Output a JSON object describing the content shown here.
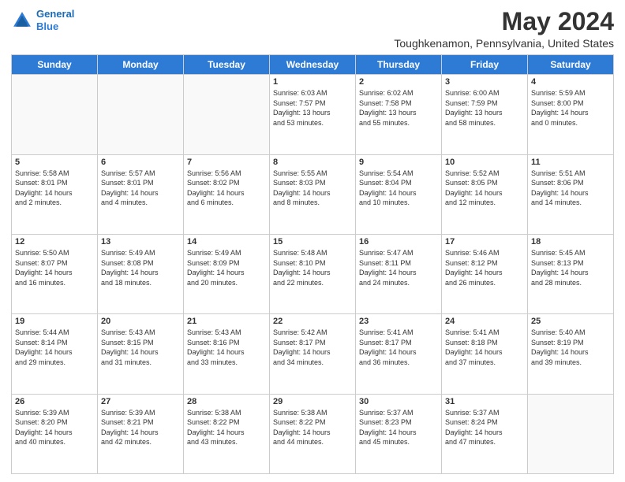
{
  "header": {
    "logo_line1": "General",
    "logo_line2": "Blue",
    "main_title": "May 2024",
    "subtitle": "Toughkenamon, Pennsylvania, United States"
  },
  "days_of_week": [
    "Sunday",
    "Monday",
    "Tuesday",
    "Wednesday",
    "Thursday",
    "Friday",
    "Saturday"
  ],
  "weeks": [
    [
      {
        "day": "",
        "info": ""
      },
      {
        "day": "",
        "info": ""
      },
      {
        "day": "",
        "info": ""
      },
      {
        "day": "1",
        "info": "Sunrise: 6:03 AM\nSunset: 7:57 PM\nDaylight: 13 hours\nand 53 minutes."
      },
      {
        "day": "2",
        "info": "Sunrise: 6:02 AM\nSunset: 7:58 PM\nDaylight: 13 hours\nand 55 minutes."
      },
      {
        "day": "3",
        "info": "Sunrise: 6:00 AM\nSunset: 7:59 PM\nDaylight: 13 hours\nand 58 minutes."
      },
      {
        "day": "4",
        "info": "Sunrise: 5:59 AM\nSunset: 8:00 PM\nDaylight: 14 hours\nand 0 minutes."
      }
    ],
    [
      {
        "day": "5",
        "info": "Sunrise: 5:58 AM\nSunset: 8:01 PM\nDaylight: 14 hours\nand 2 minutes."
      },
      {
        "day": "6",
        "info": "Sunrise: 5:57 AM\nSunset: 8:01 PM\nDaylight: 14 hours\nand 4 minutes."
      },
      {
        "day": "7",
        "info": "Sunrise: 5:56 AM\nSunset: 8:02 PM\nDaylight: 14 hours\nand 6 minutes."
      },
      {
        "day": "8",
        "info": "Sunrise: 5:55 AM\nSunset: 8:03 PM\nDaylight: 14 hours\nand 8 minutes."
      },
      {
        "day": "9",
        "info": "Sunrise: 5:54 AM\nSunset: 8:04 PM\nDaylight: 14 hours\nand 10 minutes."
      },
      {
        "day": "10",
        "info": "Sunrise: 5:52 AM\nSunset: 8:05 PM\nDaylight: 14 hours\nand 12 minutes."
      },
      {
        "day": "11",
        "info": "Sunrise: 5:51 AM\nSunset: 8:06 PM\nDaylight: 14 hours\nand 14 minutes."
      }
    ],
    [
      {
        "day": "12",
        "info": "Sunrise: 5:50 AM\nSunset: 8:07 PM\nDaylight: 14 hours\nand 16 minutes."
      },
      {
        "day": "13",
        "info": "Sunrise: 5:49 AM\nSunset: 8:08 PM\nDaylight: 14 hours\nand 18 minutes."
      },
      {
        "day": "14",
        "info": "Sunrise: 5:49 AM\nSunset: 8:09 PM\nDaylight: 14 hours\nand 20 minutes."
      },
      {
        "day": "15",
        "info": "Sunrise: 5:48 AM\nSunset: 8:10 PM\nDaylight: 14 hours\nand 22 minutes."
      },
      {
        "day": "16",
        "info": "Sunrise: 5:47 AM\nSunset: 8:11 PM\nDaylight: 14 hours\nand 24 minutes."
      },
      {
        "day": "17",
        "info": "Sunrise: 5:46 AM\nSunset: 8:12 PM\nDaylight: 14 hours\nand 26 minutes."
      },
      {
        "day": "18",
        "info": "Sunrise: 5:45 AM\nSunset: 8:13 PM\nDaylight: 14 hours\nand 28 minutes."
      }
    ],
    [
      {
        "day": "19",
        "info": "Sunrise: 5:44 AM\nSunset: 8:14 PM\nDaylight: 14 hours\nand 29 minutes."
      },
      {
        "day": "20",
        "info": "Sunrise: 5:43 AM\nSunset: 8:15 PM\nDaylight: 14 hours\nand 31 minutes."
      },
      {
        "day": "21",
        "info": "Sunrise: 5:43 AM\nSunset: 8:16 PM\nDaylight: 14 hours\nand 33 minutes."
      },
      {
        "day": "22",
        "info": "Sunrise: 5:42 AM\nSunset: 8:17 PM\nDaylight: 14 hours\nand 34 minutes."
      },
      {
        "day": "23",
        "info": "Sunrise: 5:41 AM\nSunset: 8:17 PM\nDaylight: 14 hours\nand 36 minutes."
      },
      {
        "day": "24",
        "info": "Sunrise: 5:41 AM\nSunset: 8:18 PM\nDaylight: 14 hours\nand 37 minutes."
      },
      {
        "day": "25",
        "info": "Sunrise: 5:40 AM\nSunset: 8:19 PM\nDaylight: 14 hours\nand 39 minutes."
      }
    ],
    [
      {
        "day": "26",
        "info": "Sunrise: 5:39 AM\nSunset: 8:20 PM\nDaylight: 14 hours\nand 40 minutes."
      },
      {
        "day": "27",
        "info": "Sunrise: 5:39 AM\nSunset: 8:21 PM\nDaylight: 14 hours\nand 42 minutes."
      },
      {
        "day": "28",
        "info": "Sunrise: 5:38 AM\nSunset: 8:22 PM\nDaylight: 14 hours\nand 43 minutes."
      },
      {
        "day": "29",
        "info": "Sunrise: 5:38 AM\nSunset: 8:22 PM\nDaylight: 14 hours\nand 44 minutes."
      },
      {
        "day": "30",
        "info": "Sunrise: 5:37 AM\nSunset: 8:23 PM\nDaylight: 14 hours\nand 45 minutes."
      },
      {
        "day": "31",
        "info": "Sunrise: 5:37 AM\nSunset: 8:24 PM\nDaylight: 14 hours\nand 47 minutes."
      },
      {
        "day": "",
        "info": ""
      }
    ]
  ]
}
